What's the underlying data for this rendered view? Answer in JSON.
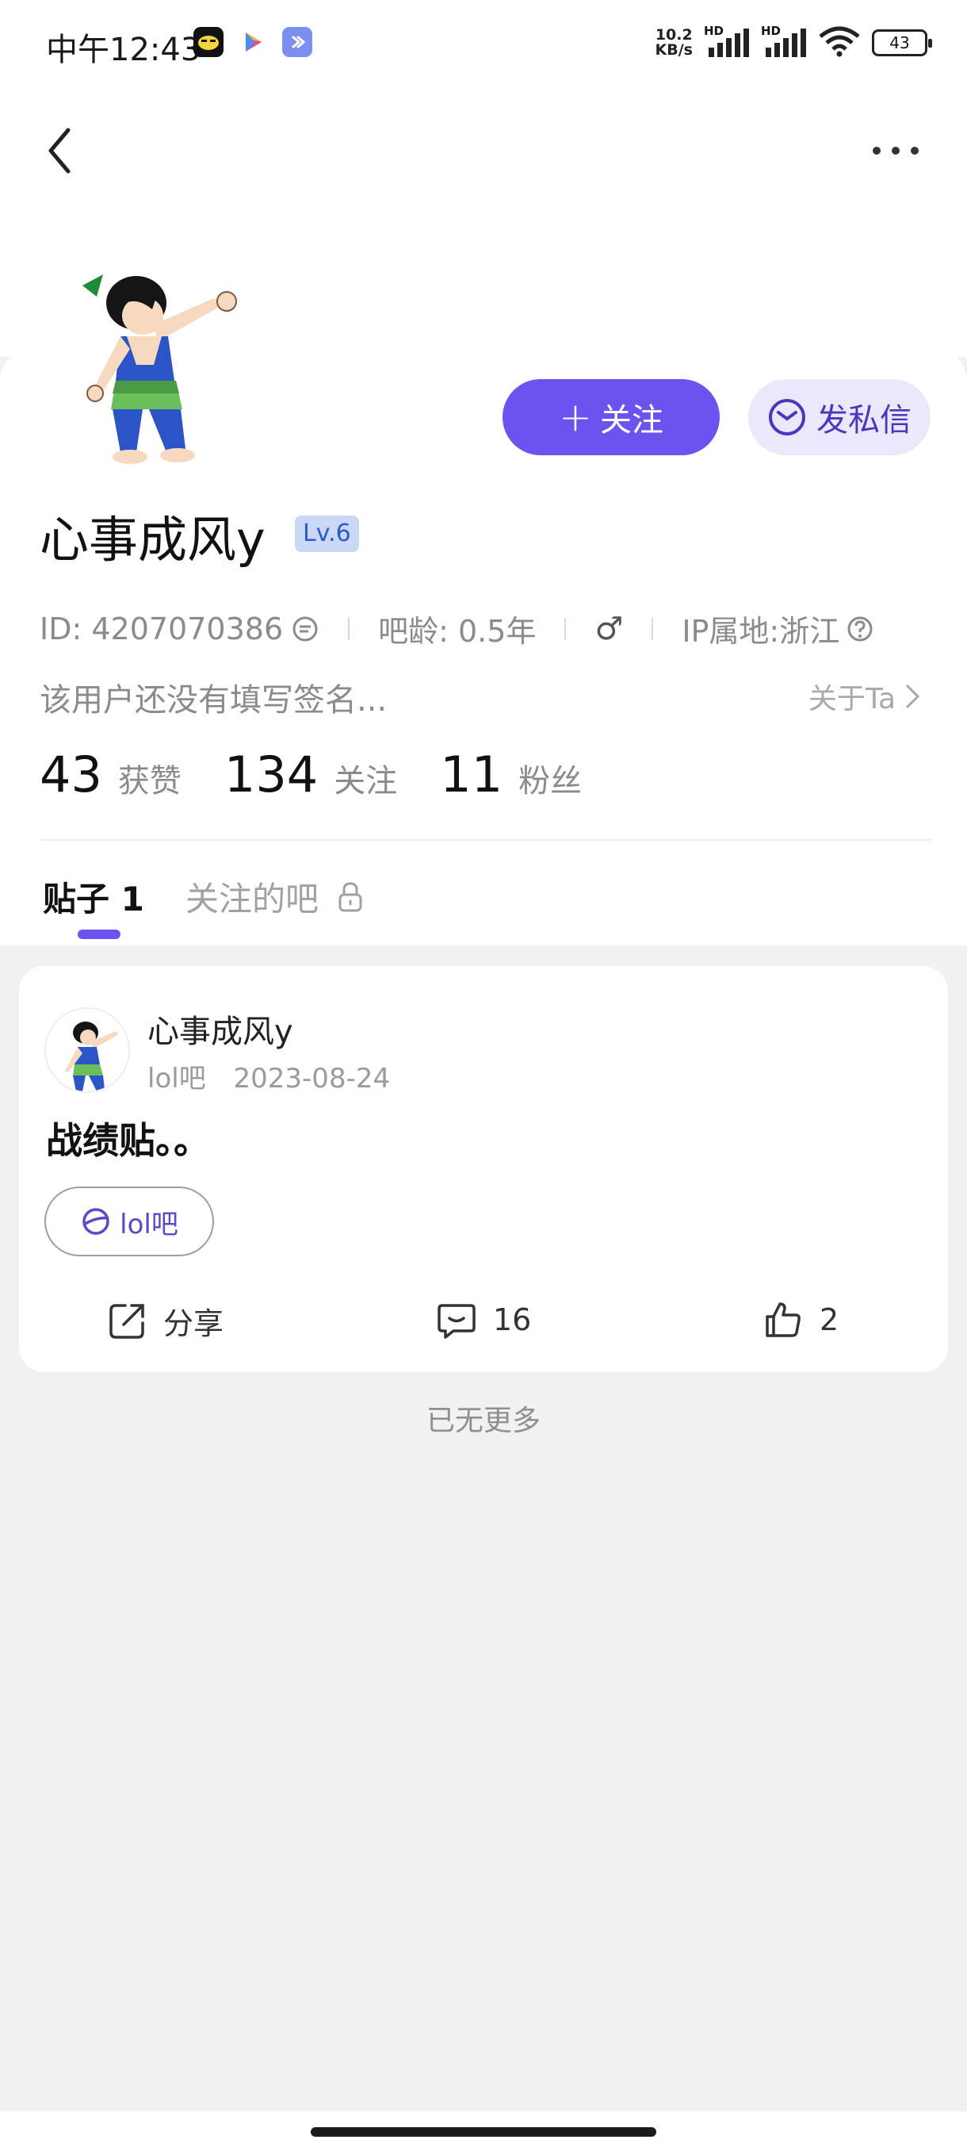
{
  "status_bar": {
    "time": "中午12:43",
    "net_speed_value": "10.2",
    "net_speed_unit": "KB/s",
    "signal_1_label": "HD",
    "signal_2_label": "HD",
    "battery": "43",
    "app_icons": [
      "qq-face-app-icon",
      "play-store-app-icon",
      "assistant-app-icon"
    ]
  },
  "header": {
    "back_icon": "chevron-left-icon",
    "more_icon": "more-dots-icon",
    "more_label": "•••"
  },
  "profile": {
    "username": "心事成风y",
    "level": "Lv.6",
    "follow_button": {
      "icon": "+",
      "label": "关注"
    },
    "message_button": {
      "label": "发私信"
    },
    "meta": {
      "id": "ID: 4207070386",
      "age": "吧龄: 0.5年",
      "gender_symbol": "♂",
      "ip": "IP属地:浙江"
    },
    "signature": "该用户还没有填写签名...",
    "about_link": "关于Ta",
    "stats": [
      {
        "num": "43",
        "label": "获赞"
      },
      {
        "num": "134",
        "label": "关注"
      },
      {
        "num": "11",
        "label": "粉丝"
      }
    ]
  },
  "tabs": {
    "posts": "贴子 1",
    "followed_bars": "关注的吧"
  },
  "post": {
    "author": "心事成风y",
    "bar": "lol吧",
    "date": "2023-08-24",
    "title": "战绩贴。。",
    "chip": "lol吧",
    "share_label": "分享",
    "comments": "16",
    "likes": "2"
  },
  "footer": {
    "no_more": "已无更多"
  },
  "colors": {
    "accent": "#6d52f0",
    "accent_light": "#ece8fc",
    "level_bg": "#c9d8f7",
    "page_bg": "#f1f1f3"
  }
}
